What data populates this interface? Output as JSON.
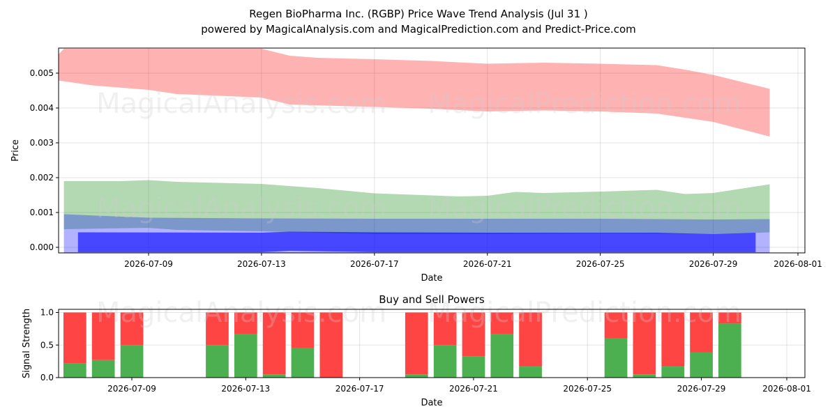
{
  "header": {
    "title_line1": "Regen BioPharma Inc. (RGBP) Price Wave Trend Analysis (Jul 31 )",
    "title_line2": "powered by MagicalAnalysis.com and MagicalPrediction.com and Predict-Price.com"
  },
  "watermarks": [
    "MagicalAnalysis.com",
    "MagicalPrediction.com"
  ],
  "chart_data": [
    {
      "type": "area",
      "title": "",
      "xlabel": "Date",
      "ylabel": "Price",
      "x_ticks": [
        "2026-07-09",
        "2026-07-13",
        "2026-07-17",
        "2026-07-21",
        "2026-07-25",
        "2026-07-29",
        "2026-08-01"
      ],
      "y_ticks": [
        "0.000",
        "0.001",
        "0.002",
        "0.003",
        "0.004",
        "0.005"
      ],
      "xlim": [
        "2026-07-05",
        "2026-08-01"
      ],
      "ylim": [
        -0.00017,
        0.0057
      ],
      "grid": true,
      "series": [
        {
          "color": "#ff0000",
          "opacity": 0.3,
          "upper": [
            {
              "x": "2026-07-06",
              "y": 0.0057
            },
            {
              "x": "2026-07-13",
              "y": 0.0057
            },
            {
              "x": "2026-07-14",
              "y": 0.0055
            },
            {
              "x": "2026-07-15",
              "y": 0.00544
            },
            {
              "x": "2026-07-17",
              "y": 0.0054
            },
            {
              "x": "2026-07-19",
              "y": 0.00535
            },
            {
              "x": "2026-07-21",
              "y": 0.00527
            },
            {
              "x": "2026-07-23",
              "y": 0.0053
            },
            {
              "x": "2026-07-25",
              "y": 0.00527
            },
            {
              "x": "2026-07-27",
              "y": 0.00523
            },
            {
              "x": "2026-07-28",
              "y": 0.0051
            },
            {
              "x": "2026-07-29",
              "y": 0.00495
            },
            {
              "x": "2026-07-31",
              "y": 0.00455
            }
          ],
          "lower": [
            {
              "x": "2026-07-05",
              "y": 0.00488
            },
            {
              "x": "2026-07-07",
              "y": 0.00465
            },
            {
              "x": "2026-07-09",
              "y": 0.00452
            },
            {
              "x": "2026-07-10",
              "y": 0.0044
            },
            {
              "x": "2026-07-13",
              "y": 0.0043
            },
            {
              "x": "2026-07-14",
              "y": 0.0041
            },
            {
              "x": "2026-07-17",
              "y": 0.00403
            },
            {
              "x": "2026-07-19",
              "y": 0.00398
            },
            {
              "x": "2026-07-21",
              "y": 0.0039
            },
            {
              "x": "2026-07-23",
              "y": 0.00393
            },
            {
              "x": "2026-07-25",
              "y": 0.0039
            },
            {
              "x": "2026-07-27",
              "y": 0.00384
            },
            {
              "x": "2026-07-29",
              "y": 0.0036
            },
            {
              "x": "2026-07-31",
              "y": 0.00318
            }
          ]
        },
        {
          "color": "#008000",
          "opacity": 0.3,
          "upper": [
            {
              "x": "2026-07-06",
              "y": 0.0019
            },
            {
              "x": "2026-07-08",
              "y": 0.0019
            },
            {
              "x": "2026-07-09",
              "y": 0.00193
            },
            {
              "x": "2026-07-10",
              "y": 0.00188
            },
            {
              "x": "2026-07-13",
              "y": 0.00182
            },
            {
              "x": "2026-07-15",
              "y": 0.0017
            },
            {
              "x": "2026-07-17",
              "y": 0.00155
            },
            {
              "x": "2026-07-20",
              "y": 0.00146
            },
            {
              "x": "2026-07-21",
              "y": 0.00148
            },
            {
              "x": "2026-07-22",
              "y": 0.00159
            },
            {
              "x": "2026-07-23",
              "y": 0.00156
            },
            {
              "x": "2026-07-25",
              "y": 0.0016
            },
            {
              "x": "2026-07-27",
              "y": 0.00165
            },
            {
              "x": "2026-07-28",
              "y": 0.00153
            },
            {
              "x": "2026-07-29",
              "y": 0.00156
            },
            {
              "x": "2026-07-31",
              "y": 0.00181
            }
          ],
          "lower": [
            {
              "x": "2026-07-06",
              "y": 0.00052
            },
            {
              "x": "2026-07-09",
              "y": 0.00056
            },
            {
              "x": "2026-07-10",
              "y": 0.0005
            },
            {
              "x": "2026-07-13",
              "y": 0.00046
            },
            {
              "x": "2026-07-17",
              "y": 0.00038
            },
            {
              "x": "2026-07-21",
              "y": 0.00038
            },
            {
              "x": "2026-07-25",
              "y": 0.0004
            },
            {
              "x": "2026-07-29",
              "y": 0.00038
            },
            {
              "x": "2026-07-31",
              "y": 0.00043
            }
          ]
        },
        {
          "color": "#0000ff",
          "opacity": 0.3,
          "upper": [
            {
              "x": "2026-07-06",
              "y": 0.00095
            },
            {
              "x": "2026-07-09",
              "y": 0.00085
            },
            {
              "x": "2026-07-13",
              "y": 0.00083
            },
            {
              "x": "2026-07-17",
              "y": 0.00082
            },
            {
              "x": "2026-07-21",
              "y": 0.00082
            },
            {
              "x": "2026-07-25",
              "y": 0.00082
            },
            {
              "x": "2026-07-29",
              "y": 0.0008
            },
            {
              "x": "2026-07-31",
              "y": 0.00081
            }
          ],
          "lower": [
            {
              "x": "2026-07-06",
              "y": -0.00017
            },
            {
              "x": "2026-07-31",
              "y": -0.00017
            }
          ]
        },
        {
          "color": "#0000ff",
          "opacity": 0.6,
          "upper": [
            {
              "x": "2026-07-06.5",
              "y": 0.00043
            },
            {
              "x": "2026-07-13",
              "y": 0.00042
            },
            {
              "x": "2026-07-14",
              "y": 0.00045
            },
            {
              "x": "2026-07-17",
              "y": 0.00043
            },
            {
              "x": "2026-07-21",
              "y": 0.00042
            },
            {
              "x": "2026-07-25",
              "y": 0.00042
            },
            {
              "x": "2026-07-27",
              "y": 0.00042
            },
            {
              "x": "2026-07-29",
              "y": 0.00038
            },
            {
              "x": "2026-07-30.5",
              "y": 0.00042
            }
          ],
          "lower": [
            {
              "x": "2026-07-06.5",
              "y": -0.00014
            },
            {
              "x": "2026-07-13",
              "y": -0.00014
            },
            {
              "x": "2026-07-14",
              "y": -0.0001
            },
            {
              "x": "2026-07-17",
              "y": -0.00014
            },
            {
              "x": "2026-07-30.5",
              "y": -0.00014
            }
          ]
        }
      ]
    },
    {
      "type": "bar",
      "title": "Buy and Sell Powers",
      "xlabel": "Date",
      "ylabel": "Signal Strength",
      "x_ticks": [
        "2026-07-09",
        "2026-07-13",
        "2026-07-17",
        "2026-07-21",
        "2026-07-25",
        "2026-07-29",
        "2026-08-01"
      ],
      "y_ticks": [
        "0.0",
        "0.5",
        "1.0"
      ],
      "xlim": [
        "2026-07-05",
        "2026-08-01"
      ],
      "ylim": [
        0,
        1.05
      ],
      "grid": true,
      "colors": {
        "buy": "#4caf50",
        "sell": "#ff4444"
      },
      "bars": [
        {
          "x": "2026-07-07",
          "buy": 0.22
        },
        {
          "x": "2026-07-08",
          "buy": 0.27
        },
        {
          "x": "2026-07-09",
          "buy": 0.5
        },
        {
          "x": "2026-07-12",
          "buy": 0.5
        },
        {
          "x": "2026-07-13",
          "buy": 0.67
        },
        {
          "x": "2026-07-14",
          "buy": 0.05
        },
        {
          "x": "2026-07-15",
          "buy": 0.45
        },
        {
          "x": "2026-07-16",
          "buy": 0.0
        },
        {
          "x": "2026-07-19",
          "buy": 0.05
        },
        {
          "x": "2026-07-20",
          "buy": 0.5
        },
        {
          "x": "2026-07-21",
          "buy": 0.33
        },
        {
          "x": "2026-07-22",
          "buy": 0.67
        },
        {
          "x": "2026-07-23",
          "buy": 0.17
        },
        {
          "x": "2026-07-26",
          "buy": 0.61
        },
        {
          "x": "2026-07-27",
          "buy": 0.05
        },
        {
          "x": "2026-07-28",
          "buy": 0.17
        },
        {
          "x": "2026-07-29",
          "buy": 0.39
        },
        {
          "x": "2026-07-30",
          "buy": 0.83
        }
      ]
    }
  ]
}
